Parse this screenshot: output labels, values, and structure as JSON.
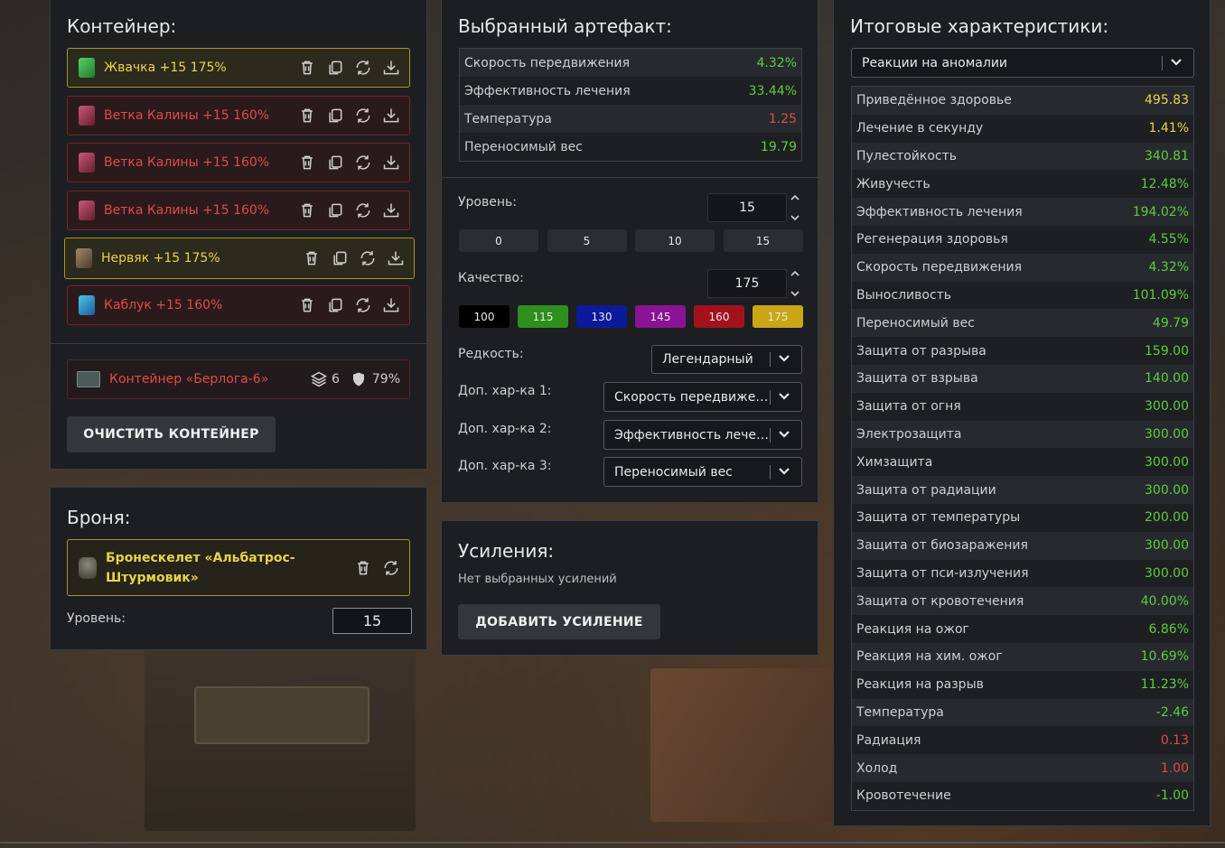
{
  "container_panel": {
    "title": "Контейнер:",
    "slots": [
      {
        "name": "Жвачка +15 175%",
        "icon": "green-crystal-icon",
        "color": "gold"
      },
      {
        "name": "Ветка Калины +15 160%",
        "icon": "viburnum-branch-icon",
        "color": "red"
      },
      {
        "name": "Ветка Калины +15 160%",
        "icon": "viburnum-branch-icon",
        "color": "red"
      },
      {
        "name": "Ветка Калины +15 160%",
        "icon": "viburnum-branch-icon",
        "color": "red"
      },
      {
        "name": "Нервяк +15 175%",
        "icon": "nerve-artifact-icon",
        "color": "gold"
      },
      {
        "name": "Каблук +15 160%",
        "icon": "heel-artifact-icon",
        "color": "red"
      }
    ],
    "container_item": {
      "name": "Контейнер «Берлога-6»",
      "capacity": "6",
      "protection": "79%"
    },
    "clear_button": "ОЧИСТИТЬ КОНТЕЙНЕР"
  },
  "armor_panel": {
    "title": "Броня:",
    "armor_name": "Бронескелет «Альбатрос-Штурмовик»",
    "level_label": "Уровень:",
    "level_value": "15"
  },
  "artifact_panel": {
    "title": "Выбранный артефакт:",
    "stats": [
      {
        "k": "Скорость передвижения",
        "v": "4.32%",
        "c": "green"
      },
      {
        "k": "Эффективность лечения",
        "v": "33.44%",
        "c": "green"
      },
      {
        "k": "Температура",
        "v": "1.25",
        "c": "red"
      },
      {
        "k": "Переносимый вес",
        "v": "19.79",
        "c": "green"
      }
    ],
    "level_label": "Уровень:",
    "level_value": "15",
    "level_presets": [
      "0",
      "5",
      "10",
      "15"
    ],
    "quality_label": "Качество:",
    "quality_value": "175",
    "quality_presets": [
      {
        "label": "100",
        "color": "#000000"
      },
      {
        "label": "115",
        "color": "#2e8f1c"
      },
      {
        "label": "130",
        "color": "#0a1a9a"
      },
      {
        "label": "145",
        "color": "#8a1296"
      },
      {
        "label": "160",
        "color": "#a3121c"
      },
      {
        "label": "175",
        "color": "#c9a616"
      }
    ],
    "rarity_label": "Редкость:",
    "rarity_value": "Легендарный",
    "extra1_label": "Доп. хар-ка 1:",
    "extra1_value": "Скорость передвижения",
    "extra2_label": "Доп. хар-ка 2:",
    "extra2_value": "Эффективность лечения",
    "extra3_label": "Доп. хар-ка 3:",
    "extra3_value": "Переносимый вес"
  },
  "boosts_panel": {
    "title": "Усиления:",
    "empty_text": "Нет выбранных усилений",
    "add_button": "ДОБАВИТЬ УСИЛЕНИЕ"
  },
  "totals_panel": {
    "title": "Итоговые характеристики:",
    "filter_value": "Реакции на аномалии",
    "stats": [
      {
        "k": "Приведённое здоровье",
        "v": "495.83",
        "c": "gold"
      },
      {
        "k": "Лечение в секунду",
        "v": "1.41%",
        "c": "gold"
      },
      {
        "k": "Пулестойкость",
        "v": "340.81",
        "c": "green"
      },
      {
        "k": "Живучесть",
        "v": "12.48%",
        "c": "green"
      },
      {
        "k": "Эффективность лечения",
        "v": "194.02%",
        "c": "green"
      },
      {
        "k": "Регенерация здоровья",
        "v": "4.55%",
        "c": "green"
      },
      {
        "k": "Скорость передвижения",
        "v": "4.32%",
        "c": "green"
      },
      {
        "k": "Выносливость",
        "v": "101.09%",
        "c": "green"
      },
      {
        "k": "Переносимый вес",
        "v": "49.79",
        "c": "green"
      },
      {
        "k": "Защита от разрыва",
        "v": "159.00",
        "c": "green"
      },
      {
        "k": "Защита от взрыва",
        "v": "140.00",
        "c": "green"
      },
      {
        "k": "Защита от огня",
        "v": "300.00",
        "c": "green"
      },
      {
        "k": "Электрозащита",
        "v": "300.00",
        "c": "green"
      },
      {
        "k": "Химзащита",
        "v": "300.00",
        "c": "green"
      },
      {
        "k": "Защита от радиации",
        "v": "300.00",
        "c": "green"
      },
      {
        "k": "Защита от температуры",
        "v": "200.00",
        "c": "green"
      },
      {
        "k": "Защита от биозаражения",
        "v": "300.00",
        "c": "green"
      },
      {
        "k": "Защита от пси-излучения",
        "v": "300.00",
        "c": "green"
      },
      {
        "k": "Защита от кровотечения",
        "v": "40.00%",
        "c": "green"
      },
      {
        "k": "Реакция на ожог",
        "v": "6.86%",
        "c": "green"
      },
      {
        "k": "Реакция на хим. ожог",
        "v": "10.69%",
        "c": "green"
      },
      {
        "k": "Реакция на разрыв",
        "v": "11.23%",
        "c": "green"
      },
      {
        "k": "Температура",
        "v": "-2.46",
        "c": "green"
      },
      {
        "k": "Радиация",
        "v": "0.13",
        "c": "red"
      },
      {
        "k": "Холод",
        "v": "1.00",
        "c": "red"
      },
      {
        "k": "Кровотечение",
        "v": "-1.00",
        "c": "green"
      }
    ]
  }
}
